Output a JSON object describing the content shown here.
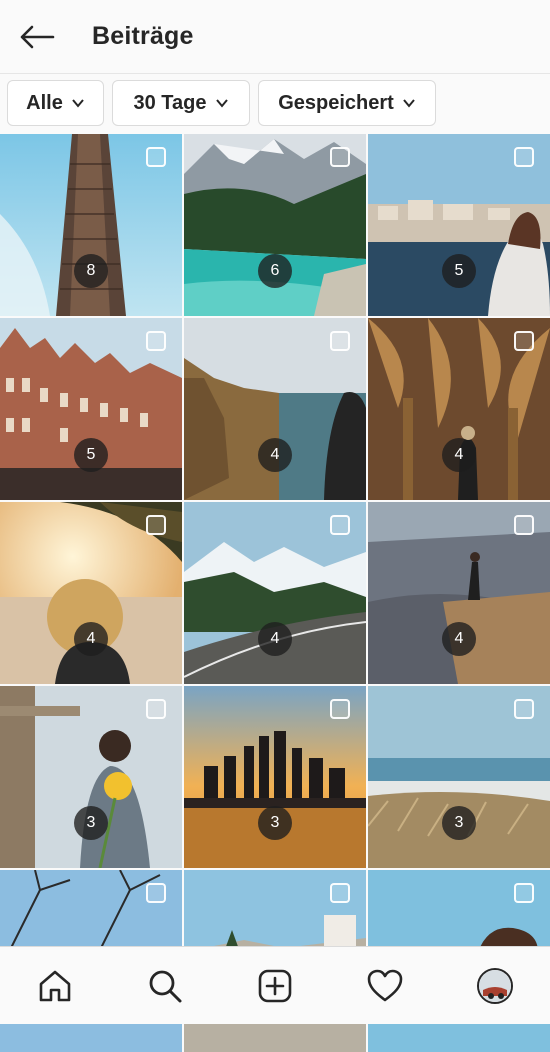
{
  "header": {
    "title": "Beiträge",
    "back_icon": "arrow-left-icon"
  },
  "filters": [
    {
      "label": "Alle"
    },
    {
      "label": "30 Tage"
    },
    {
      "label": "Gespeichert"
    }
  ],
  "posts": [
    {
      "count": "8"
    },
    {
      "count": "6"
    },
    {
      "count": "5"
    },
    {
      "count": "5"
    },
    {
      "count": "4"
    },
    {
      "count": "4"
    },
    {
      "count": "4"
    },
    {
      "count": "4"
    },
    {
      "count": "4"
    },
    {
      "count": "3"
    },
    {
      "count": "3"
    },
    {
      "count": "3"
    },
    {
      "count": ""
    },
    {
      "count": ""
    },
    {
      "count": ""
    }
  ],
  "bottom_nav": [
    "home-icon",
    "search-icon",
    "new-post-icon",
    "heart-icon",
    "profile-avatar"
  ]
}
